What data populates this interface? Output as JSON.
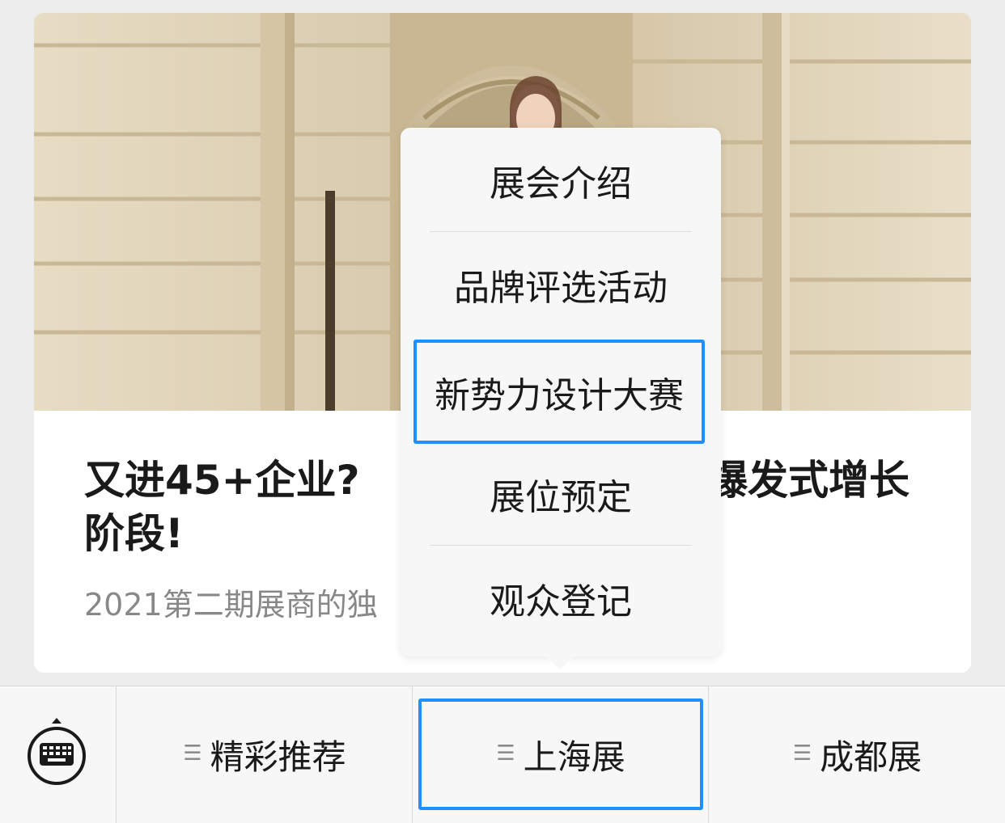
{
  "article": {
    "title_line1": "又进45+企业?",
    "title_right": "爆发式增长",
    "title_line2": "阶段!",
    "subtitle": "2021第二期展商的独"
  },
  "popup_menu": {
    "items": [
      {
        "label": "展会介绍"
      },
      {
        "label": "品牌评选活动"
      },
      {
        "label": "新势力设计大赛"
      },
      {
        "label": "展位预定"
      },
      {
        "label": "观众登记"
      }
    ],
    "highlighted_index": 2
  },
  "bottom_bar": {
    "keyboard_icon": "keyboard-icon",
    "tabs": [
      {
        "label": "精彩推荐",
        "icon": "menu-lines-icon"
      },
      {
        "label": "上海展",
        "icon": "menu-lines-icon"
      },
      {
        "label": "成都展",
        "icon": "menu-lines-icon"
      }
    ],
    "active_tab_index": 1
  },
  "colors": {
    "highlight": "#1e90ff",
    "background": "#ededed",
    "popup_bg": "#f7f7f7",
    "text_primary": "#1a1a1a",
    "text_secondary": "#888888"
  }
}
